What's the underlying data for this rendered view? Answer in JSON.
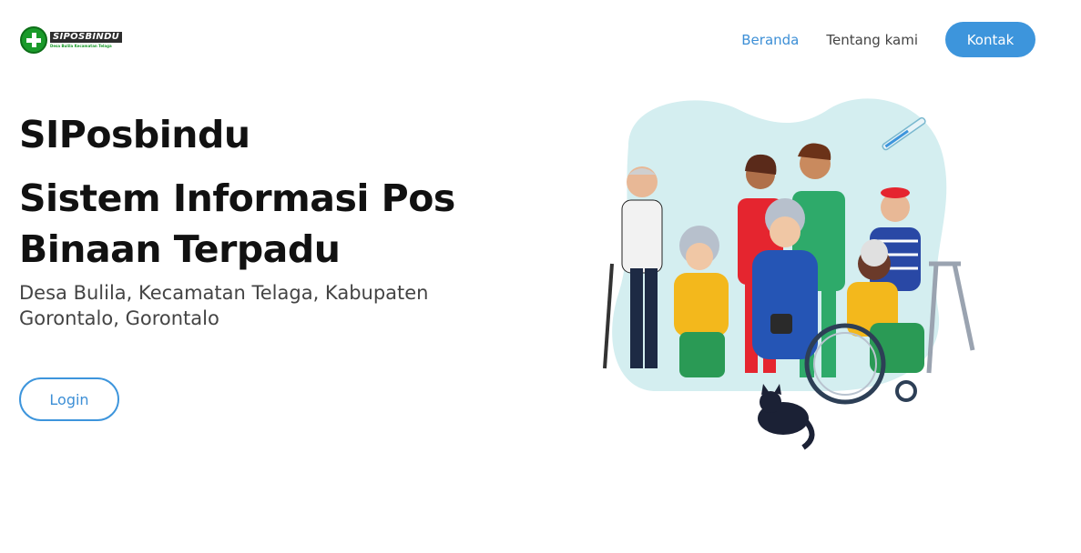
{
  "header": {
    "logo": {
      "title": "SIPOSBINDU",
      "subtitle": "Desa Bulila Kecamatan Telaga"
    },
    "nav": [
      {
        "label": "Beranda",
        "active": true
      },
      {
        "label": "Tentang kami",
        "active": false
      }
    ],
    "cta_label": "Kontak"
  },
  "hero": {
    "title": "SIPosbindu",
    "subtitle": "Sistem Informasi Pos Binaan Terpadu",
    "description": "Desa Bulila, Kecamatan Telaga, Kabupaten Gorontalo, Gorontalo",
    "login_label": "Login"
  },
  "colors": {
    "accent": "#3d95dc",
    "logo_green": "#1a9a2a",
    "blob": "#d4eef0"
  },
  "illustration": {
    "icon": "elderly-care-group-illustration"
  }
}
